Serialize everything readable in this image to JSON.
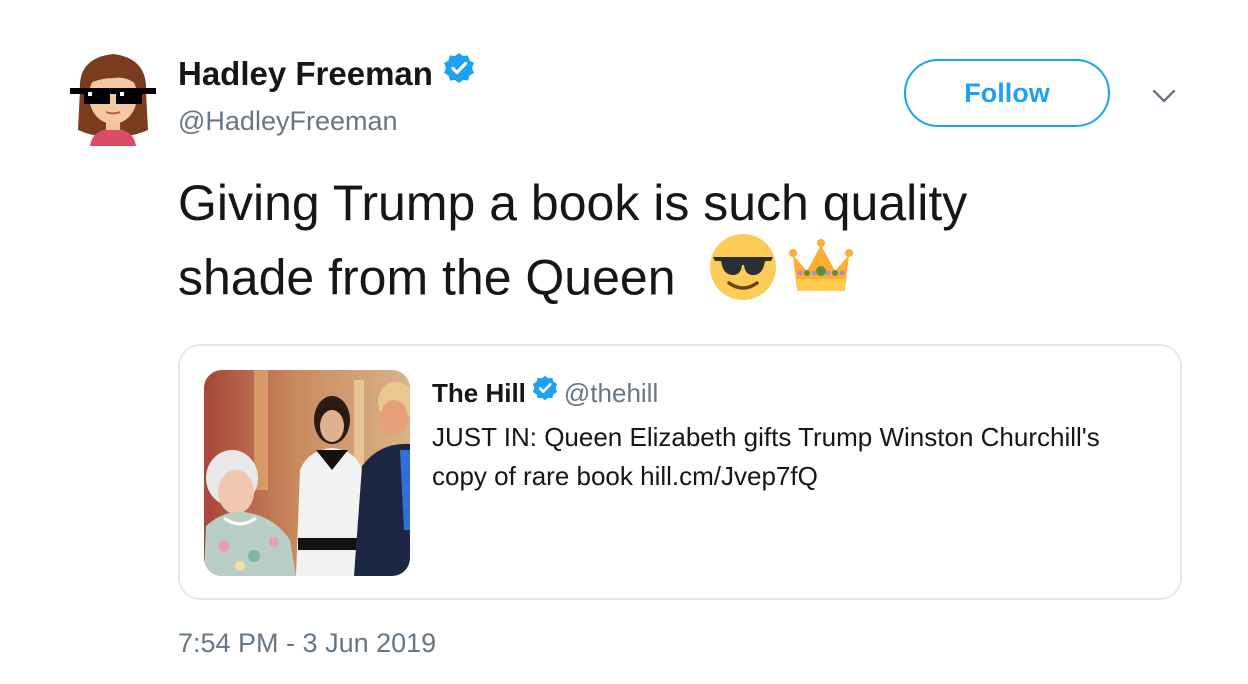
{
  "author": {
    "display_name": "Hadley Freeman",
    "handle": "@HadleyFreeman",
    "verified": true,
    "avatar_icon": "bitmoji-avatar-with-pixel-sunglasses"
  },
  "follow_button": {
    "label": "Follow"
  },
  "menu": {
    "icon": "chevron-down-icon"
  },
  "tweet": {
    "text_lines": [
      "Giving Trump a book is such quality",
      "shade from the Queen"
    ],
    "emojis": [
      "smiling-face-with-sunglasses",
      "crown"
    ]
  },
  "quoted_tweet": {
    "author_name": "The Hill",
    "author_handle": "@thehill",
    "verified": true,
    "text_lines": [
      "JUST IN: Queen Elizabeth gifts Trump Winston Churchill's",
      "copy of rare book hill.cm/Jvep7fQ"
    ],
    "image": "photo-queen-melania-trump"
  },
  "timestamp": "7:54 PM - 3 Jun 2019",
  "colors": {
    "accent": "#1da1f2",
    "text_primary": "#14171a",
    "text_secondary": "#657786",
    "border": "#e1e8ed"
  }
}
